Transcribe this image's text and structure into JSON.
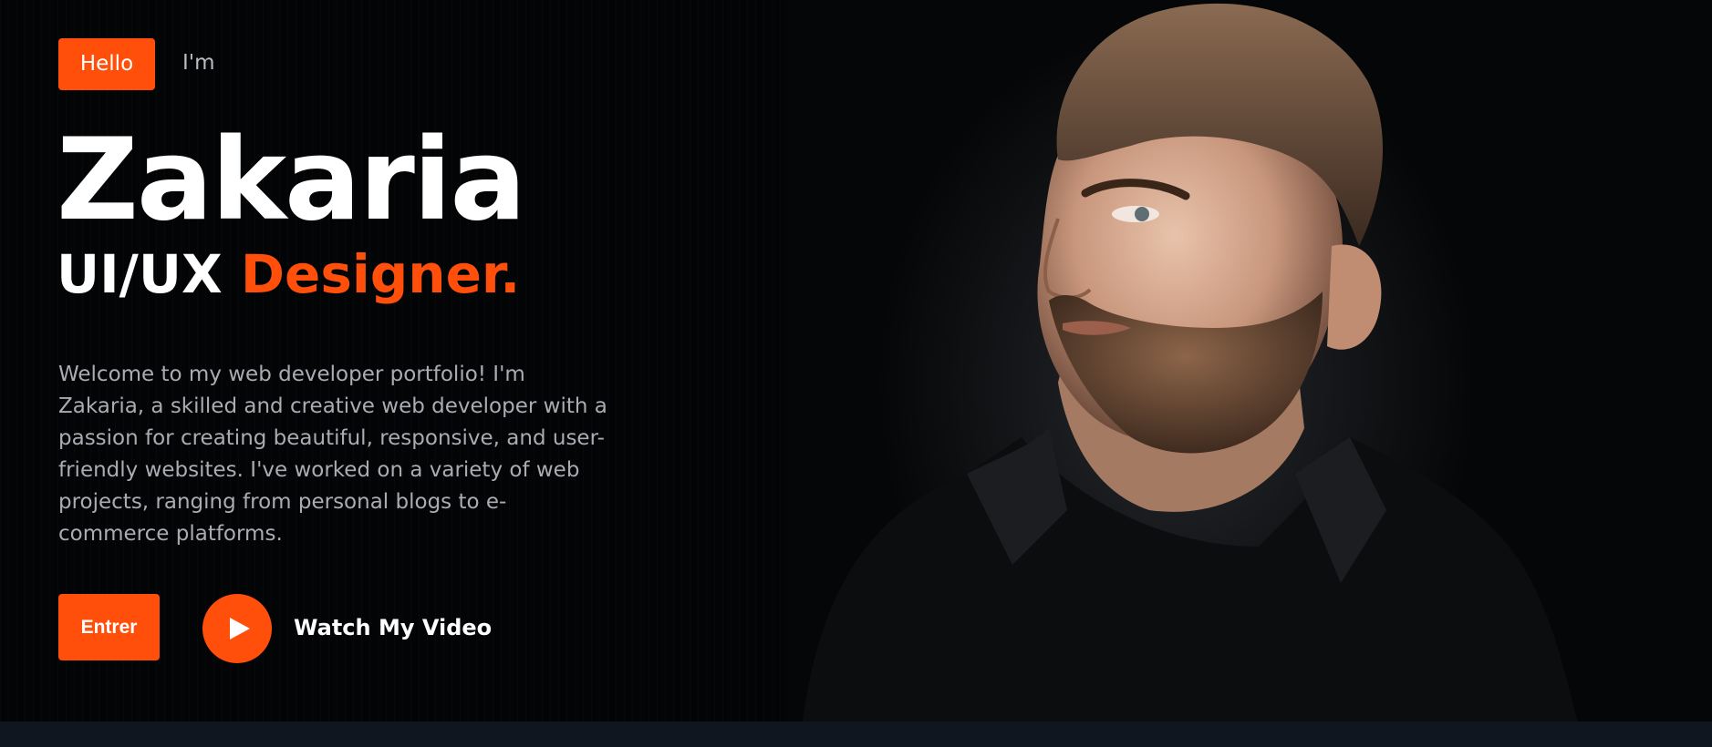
{
  "hero": {
    "hello_label": "Hello",
    "im_text": "I'm",
    "name": "Zakaria",
    "role_prefix": "UI/UX",
    "role_accent": "Designer.",
    "description": "Welcome to my web developer portfolio! I'm Zakaria, a skilled and creative web developer with a passion for creating beautiful, responsive, and user-friendly websites. I've worked on a variety of web projects, ranging from personal blogs to e-commerce platforms.",
    "entrer_label": "Entrer",
    "video_label": "Watch My Video"
  },
  "icons": {
    "play": "play-icon"
  },
  "colors": {
    "accent": "#ff4f0a",
    "background": "#030405",
    "text_primary": "#ffffff",
    "text_muted": "#a9acb2",
    "bottom_bar": "#101620"
  }
}
